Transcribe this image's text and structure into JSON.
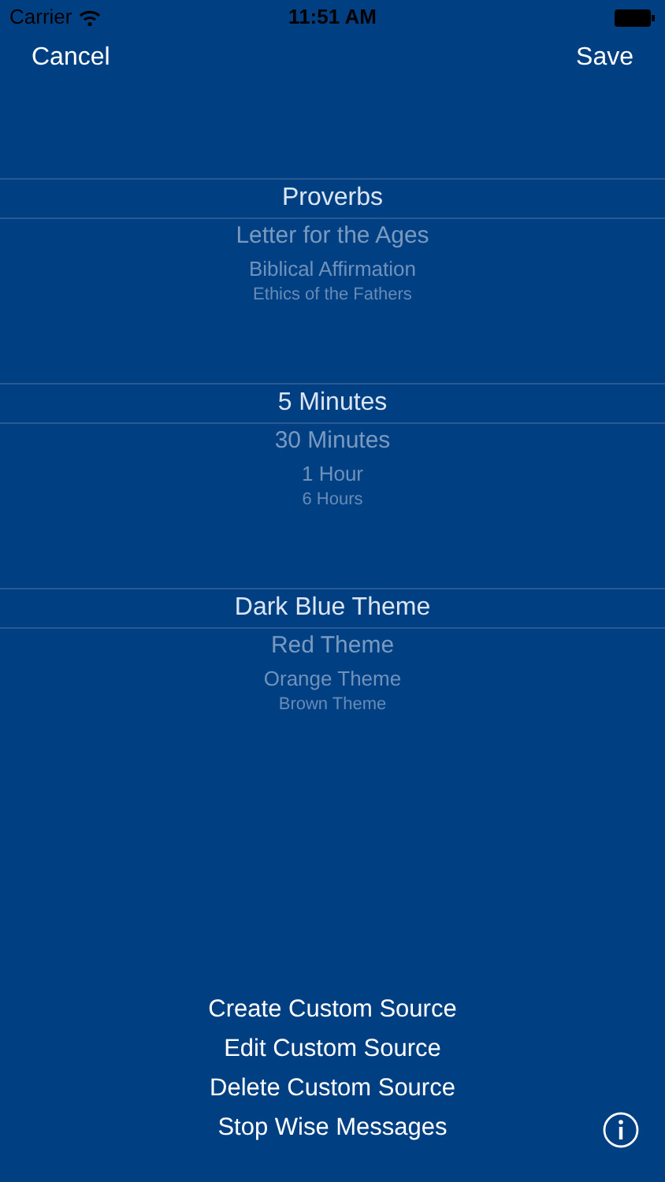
{
  "status_bar": {
    "carrier": "Carrier",
    "time": "11:51 AM"
  },
  "nav": {
    "cancel": "Cancel",
    "save": "Save"
  },
  "pickers": [
    {
      "options": [
        {
          "label": "Proverbs",
          "selected": true
        },
        {
          "label": "Letter for the Ages",
          "selected": false
        },
        {
          "label": "Biblical Affirmation",
          "selected": false
        },
        {
          "label": "Ethics of the Fathers",
          "selected": false
        }
      ]
    },
    {
      "options": [
        {
          "label": "5 Minutes",
          "selected": true
        },
        {
          "label": "30 Minutes",
          "selected": false
        },
        {
          "label": "1 Hour",
          "selected": false
        },
        {
          "label": "6 Hours",
          "selected": false
        }
      ]
    },
    {
      "options": [
        {
          "label": "Dark Blue Theme",
          "selected": true
        },
        {
          "label": "Red Theme",
          "selected": false
        },
        {
          "label": "Orange Theme",
          "selected": false
        },
        {
          "label": "Brown Theme",
          "selected": false
        }
      ]
    }
  ],
  "actions": [
    "Create Custom Source",
    "Edit Custom Source",
    "Delete Custom Source",
    "Stop Wise Messages"
  ]
}
